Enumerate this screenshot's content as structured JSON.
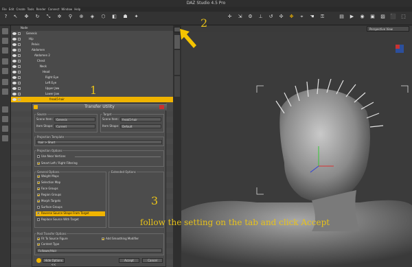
{
  "titlebar": {
    "title": "DAZ Studio 4.5 Pro"
  },
  "menu": [
    "File",
    "Edit",
    "Create",
    "Tools",
    "Render",
    "Connect",
    "Window",
    "Help"
  ],
  "scene": {
    "header": "Node",
    "rows": [
      {
        "label": "Genesis",
        "indent": 6,
        "selected": false
      },
      {
        "label": "Hip",
        "indent": 10,
        "selected": false
      },
      {
        "label": "Pelvis",
        "indent": 14,
        "selected": false
      },
      {
        "label": "Abdomen",
        "indent": 14,
        "selected": false
      },
      {
        "label": "Abdomen 2",
        "indent": 18,
        "selected": false
      },
      {
        "label": "Chest",
        "indent": 22,
        "selected": false
      },
      {
        "label": "Neck",
        "indent": 26,
        "selected": false
      },
      {
        "label": "Head",
        "indent": 30,
        "selected": false
      },
      {
        "label": "Right Eye",
        "indent": 34,
        "selected": false
      },
      {
        "label": "Left Eye",
        "indent": 34,
        "selected": false
      },
      {
        "label": "Upper Jaw",
        "indent": 34,
        "selected": false
      },
      {
        "label": "Lower Jaw",
        "indent": 34,
        "selected": false
      },
      {
        "label": "freak5-hair",
        "indent": 40,
        "selected": true
      }
    ]
  },
  "viewport": {
    "camera": "Perspective View"
  },
  "dialog": {
    "title": "Transfer Utility",
    "source": {
      "title": "Source",
      "scene_item_label": "Scene Item:",
      "scene_item": "Genesis",
      "item_shape_label": "Item Shape:",
      "item_shape": "Current"
    },
    "target": {
      "title": "Target",
      "scene_item_label": "Scene Item:",
      "scene_item": "freak5-hair",
      "item_shape_label": "Item Shape:",
      "item_shape": "Default"
    },
    "projection_template": {
      "title": "Projection Template",
      "value": "hair > Short"
    },
    "projection_options": {
      "title": "Projection Options",
      "near_vertices": "Use Near Vertices",
      "smart_filtering": "Smart Left / Right Filtering"
    },
    "general": {
      "title": "General Options",
      "items": [
        {
          "label": "Weight Maps",
          "checked": true,
          "highlight": false
        },
        {
          "label": "Selection Map",
          "checked": true,
          "highlight": false
        },
        {
          "label": "Face Groups",
          "checked": true,
          "highlight": false
        },
        {
          "label": "Region Groups",
          "checked": true,
          "highlight": false
        },
        {
          "label": "Morph Targets",
          "checked": true,
          "highlight": false
        },
        {
          "label": "Surface Groups",
          "checked": false,
          "highlight": false
        },
        {
          "label": "Reverse Source Shape From Target",
          "checked": true,
          "highlight": true
        },
        {
          "label": "Replace Source With Target",
          "checked": false,
          "highlight": false
        }
      ]
    },
    "extended": {
      "title": "Extended Options"
    },
    "post": {
      "title": "Post Transfer Options",
      "fit_to": "Fit To Source Figure",
      "smoothing": "Add Smoothing Modifier",
      "content_type": "Content Type",
      "content_value": "Follower/Hair"
    },
    "hide_options": "Hide Options <<",
    "accept": "Accept",
    "cancel": "Cancel"
  },
  "annotations": {
    "one": "1",
    "two": "2",
    "three": "3",
    "caption": "follow the setting on the tab and click Accept"
  },
  "colors": {
    "selection": "#f0b400",
    "annotation": "#e8c21a"
  }
}
